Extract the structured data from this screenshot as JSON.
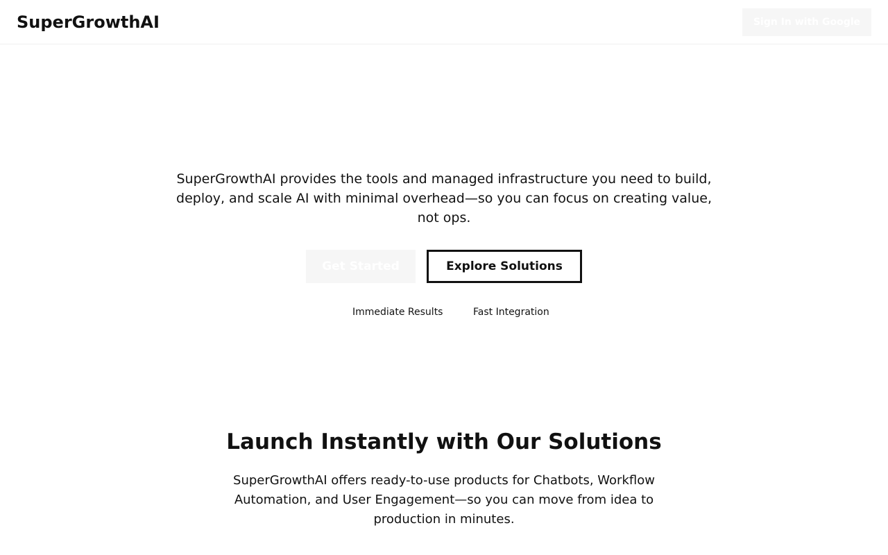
{
  "header": {
    "logo": "SuperGrowthAI",
    "signin_label": "Sign In with Google"
  },
  "hero": {
    "description": "SuperGrowthAI provides the tools and managed infrastructure you need to build, deploy, and scale AI with minimal overhead—so you can focus on creating value, not ops.",
    "get_started_label": "Get Started",
    "explore_label": "Explore Solutions",
    "features": [
      "Immediate Results",
      "Fast Integration"
    ]
  },
  "solutions": {
    "title": "Launch Instantly with Our Solutions",
    "description": "SuperGrowthAI offers ready-to-use products for Chatbots, Workflow Automation, and User Engagement—so you can move from idea to production in minutes."
  },
  "colors": {
    "text": "#111111",
    "background": "#ffffff",
    "button_faded_bg": "#f6f6f6",
    "button_faded_text": "#ffffff",
    "border": "#111111"
  }
}
